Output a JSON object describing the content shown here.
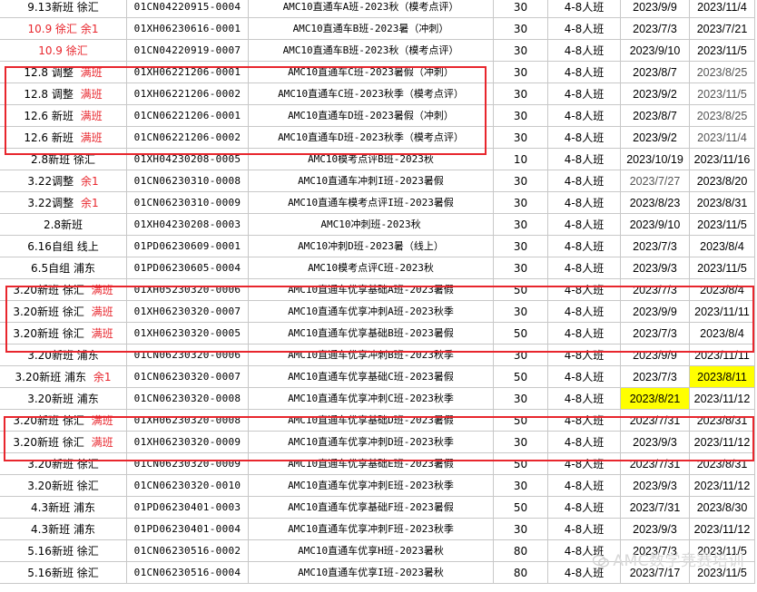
{
  "colors": {
    "red_text": "#e8262d",
    "grey_text": "#555555",
    "highlight": "#ffff00",
    "box_border": "#e8262d"
  },
  "watermark": {
    "text": "AMC数学竞赛培训",
    "icon": "wechat-icon"
  },
  "rows": [
    {
      "c0": [
        [
          "9.13新班 徐汇",
          "k"
        ]
      ],
      "code": "01CN04220915-0004",
      "course": "AMC10直通车A班-2023秋（模考点评）",
      "cap": "30",
      "size": "4-8人班",
      "start": "2023/9/9",
      "end": "2023/11/4"
    },
    {
      "c0": [
        [
          "10.9 徐汇 余1",
          "r"
        ]
      ],
      "code": "01XH06230616-0001",
      "course": "AMC10直通车B班-2023暑（冲刺）",
      "cap": "30",
      "size": "4-8人班",
      "start": "2023/7/3",
      "end": "2023/7/21"
    },
    {
      "c0": [
        [
          "10.9 徐汇",
          "r"
        ]
      ],
      "code": "01CN04220919-0007",
      "course": "AMC10直通车B班-2023秋（模考点评）",
      "cap": "30",
      "size": "4-8人班",
      "start": "2023/9/10",
      "end": "2023/11/5"
    },
    {
      "c0": [
        [
          "12.8 调整 ",
          "k"
        ],
        [
          "满班",
          "r"
        ]
      ],
      "code": "01XH06221206-0001",
      "course": "AMC10直通车C班-2023暑假（冲刺）",
      "cap": "30",
      "size": "4-8人班",
      "start": "2023/8/7",
      "end": "2023/8/25",
      "end_grey": true
    },
    {
      "c0": [
        [
          "12.8 调整 ",
          "k"
        ],
        [
          "满班",
          "r"
        ]
      ],
      "code": "01XH06221206-0002",
      "course": "AMC10直通车C班-2023秋季（模考点评）",
      "cap": "30",
      "size": "4-8人班",
      "start": "2023/9/2",
      "end": "2023/11/5",
      "end_grey": true
    },
    {
      "c0": [
        [
          "12.6 新班 ",
          "k"
        ],
        [
          "满班",
          "r"
        ]
      ],
      "code": "01CN06221206-0001",
      "course": "AMC10直通车D班-2023暑假（冲刺）",
      "cap": "30",
      "size": "4-8人班",
      "start": "2023/8/7",
      "end": "2023/8/25",
      "end_grey": true
    },
    {
      "c0": [
        [
          "12.6 新班 ",
          "k"
        ],
        [
          "满班",
          "r"
        ]
      ],
      "code": "01CN06221206-0002",
      "course": "AMC10直通车D班-2023秋季（模考点评）",
      "cap": "30",
      "size": "4-8人班",
      "start": "2023/9/2",
      "end": "2023/11/4",
      "end_grey": true
    },
    {
      "c0": [
        [
          "2.8新班 徐汇",
          "k"
        ]
      ],
      "code": "01XH04230208-0005",
      "course": "AMC10模考点评B班-2023秋",
      "cap": "10",
      "size": "4-8人班",
      "start": "2023/10/19",
      "end": "2023/11/16"
    },
    {
      "c0": [
        [
          "3.22调整 ",
          "k"
        ],
        [
          "余1",
          "r"
        ]
      ],
      "code": "01CN06230310-0008",
      "course": "AMC10直通车冲刺I班-2023暑假",
      "cap": "30",
      "size": "4-8人班",
      "start": "2023/7/27",
      "end": "2023/8/20",
      "start_grey": true
    },
    {
      "c0": [
        [
          "3.22调整 ",
          "k"
        ],
        [
          "余1",
          "r"
        ]
      ],
      "code": "01CN06230310-0009",
      "course": "AMC10直通车模考点评I班-2023暑假",
      "cap": "30",
      "size": "4-8人班",
      "start": "2023/8/23",
      "end": "2023/8/31"
    },
    {
      "c0": [
        [
          "2.8新班",
          "k"
        ]
      ],
      "code": "01XH04230208-0003",
      "course": "AMC10冲刺班-2023秋",
      "cap": "30",
      "size": "4-8人班",
      "start": "2023/9/10",
      "end": "2023/11/5"
    },
    {
      "c0": [
        [
          "6.16自组 线上",
          "k"
        ]
      ],
      "code": "01PD06230609-0001",
      "course": "AMC10冲刺D班-2023暑（线上）",
      "cap": "30",
      "size": "4-8人班",
      "start": "2023/7/3",
      "end": "2023/8/4"
    },
    {
      "c0": [
        [
          "6.5自组 浦东",
          "k"
        ]
      ],
      "code": "01PD06230605-0004",
      "course": "AMC10模考点评C班-2023秋",
      "cap": "30",
      "size": "4-8人班",
      "start": "2023/9/3",
      "end": "2023/11/5"
    },
    {
      "c0": [
        [
          "3.20新班 徐汇 ",
          "k"
        ],
        [
          "满班",
          "r"
        ]
      ],
      "code": "01XH05230320-0006",
      "course": "AMC10直通车优享基础A班-2023暑假",
      "cap": "50",
      "size": "4-8人班",
      "start": "2023/7/3",
      "end": "2023/8/4"
    },
    {
      "c0": [
        [
          "3.20新班 徐汇 ",
          "k"
        ],
        [
          "满班",
          "r"
        ]
      ],
      "code": "01XH06230320-0007",
      "course": "AMC10直通车优享冲刺A班-2023秋季",
      "cap": "30",
      "size": "4-8人班",
      "start": "2023/9/9",
      "end": "2023/11/11"
    },
    {
      "c0": [
        [
          "3.20新班 徐汇 ",
          "k"
        ],
        [
          "满班",
          "r"
        ]
      ],
      "code": "01XH06230320-0005",
      "course": "AMC10直通车优享基础B班-2023暑假",
      "cap": "50",
      "size": "4-8人班",
      "start": "2023/7/3",
      "end": "2023/8/4"
    },
    {
      "c0": [
        [
          "3.20新班 浦东",
          "k"
        ]
      ],
      "code": "01CN06230320-0006",
      "course": "AMC10直通车优享冲刺B班-2023秋季",
      "cap": "30",
      "size": "4-8人班",
      "start": "2023/9/9",
      "end": "2023/11/11"
    },
    {
      "c0": [
        [
          "3.20新班 浦东 ",
          "k"
        ],
        [
          "余1",
          "r"
        ]
      ],
      "code": "01CN06230320-0007",
      "course": "AMC10直通车优享基础C班-2023暑假",
      "cap": "50",
      "size": "4-8人班",
      "start": "2023/7/3",
      "end": "2023/8/11",
      "end_hl": true
    },
    {
      "c0": [
        [
          "3.20新班 浦东",
          "k"
        ]
      ],
      "code": "01CN06230320-0008",
      "course": "AMC10直通车优享冲刺C班-2023秋季",
      "cap": "30",
      "size": "4-8人班",
      "start": "2023/8/21",
      "end": "2023/11/12",
      "start_hl": true
    },
    {
      "c0": [
        [
          "3.20新班 徐汇 ",
          "k"
        ],
        [
          "满班",
          "r"
        ]
      ],
      "code": "01XH06230320-0008",
      "course": "AMC10直通车优享基础D班-2023暑假",
      "cap": "50",
      "size": "4-8人班",
      "start": "2023/7/31",
      "end": "2023/8/31"
    },
    {
      "c0": [
        [
          "3.20新班 徐汇 ",
          "k"
        ],
        [
          "满班",
          "r"
        ]
      ],
      "code": "01XH06230320-0009",
      "course": "AMC10直通车优享冲刺D班-2023秋季",
      "cap": "30",
      "size": "4-8人班",
      "start": "2023/9/3",
      "end": "2023/11/12"
    },
    {
      "c0": [
        [
          "3.20新班 徐汇",
          "k"
        ]
      ],
      "code": "01CN06230320-0009",
      "course": "AMC10直通车优享基础E班-2023暑假",
      "cap": "50",
      "size": "4-8人班",
      "start": "2023/7/31",
      "end": "2023/8/31"
    },
    {
      "c0": [
        [
          "3.20新班 徐汇",
          "k"
        ]
      ],
      "code": "01CN06230320-0010",
      "course": "AMC10直通车优享冲刺E班-2023秋季",
      "cap": "30",
      "size": "4-8人班",
      "start": "2023/9/3",
      "end": "2023/11/12"
    },
    {
      "c0": [
        [
          "4.3新班 浦东",
          "k"
        ]
      ],
      "code": "01PD06230401-0003",
      "course": "AMC10直通车优享基础F班-2023暑假",
      "cap": "50",
      "size": "4-8人班",
      "start": "2023/7/31",
      "end": "2023/8/30"
    },
    {
      "c0": [
        [
          "4.3新班 浦东",
          "k"
        ]
      ],
      "code": "01PD06230401-0004",
      "course": "AMC10直通车优享冲刺F班-2023秋季",
      "cap": "30",
      "size": "4-8人班",
      "start": "2023/9/3",
      "end": "2023/11/12"
    },
    {
      "c0": [
        [
          "5.16新班 徐汇",
          "k"
        ]
      ],
      "code": "01CN06230516-0002",
      "course": "AMC10直通车优享H班-2023暑秋",
      "cap": "80",
      "size": "4-8人班",
      "start": "2023/7/3",
      "end": "2023/11/5"
    },
    {
      "c0": [
        [
          "5.16新班 徐汇",
          "k"
        ]
      ],
      "code": "01CN06230516-0004",
      "course": "AMC10直通车优享I班-2023暑秋",
      "cap": "80",
      "size": "4-8人班",
      "start": "2023/7/17",
      "end": "2023/11/5"
    }
  ]
}
